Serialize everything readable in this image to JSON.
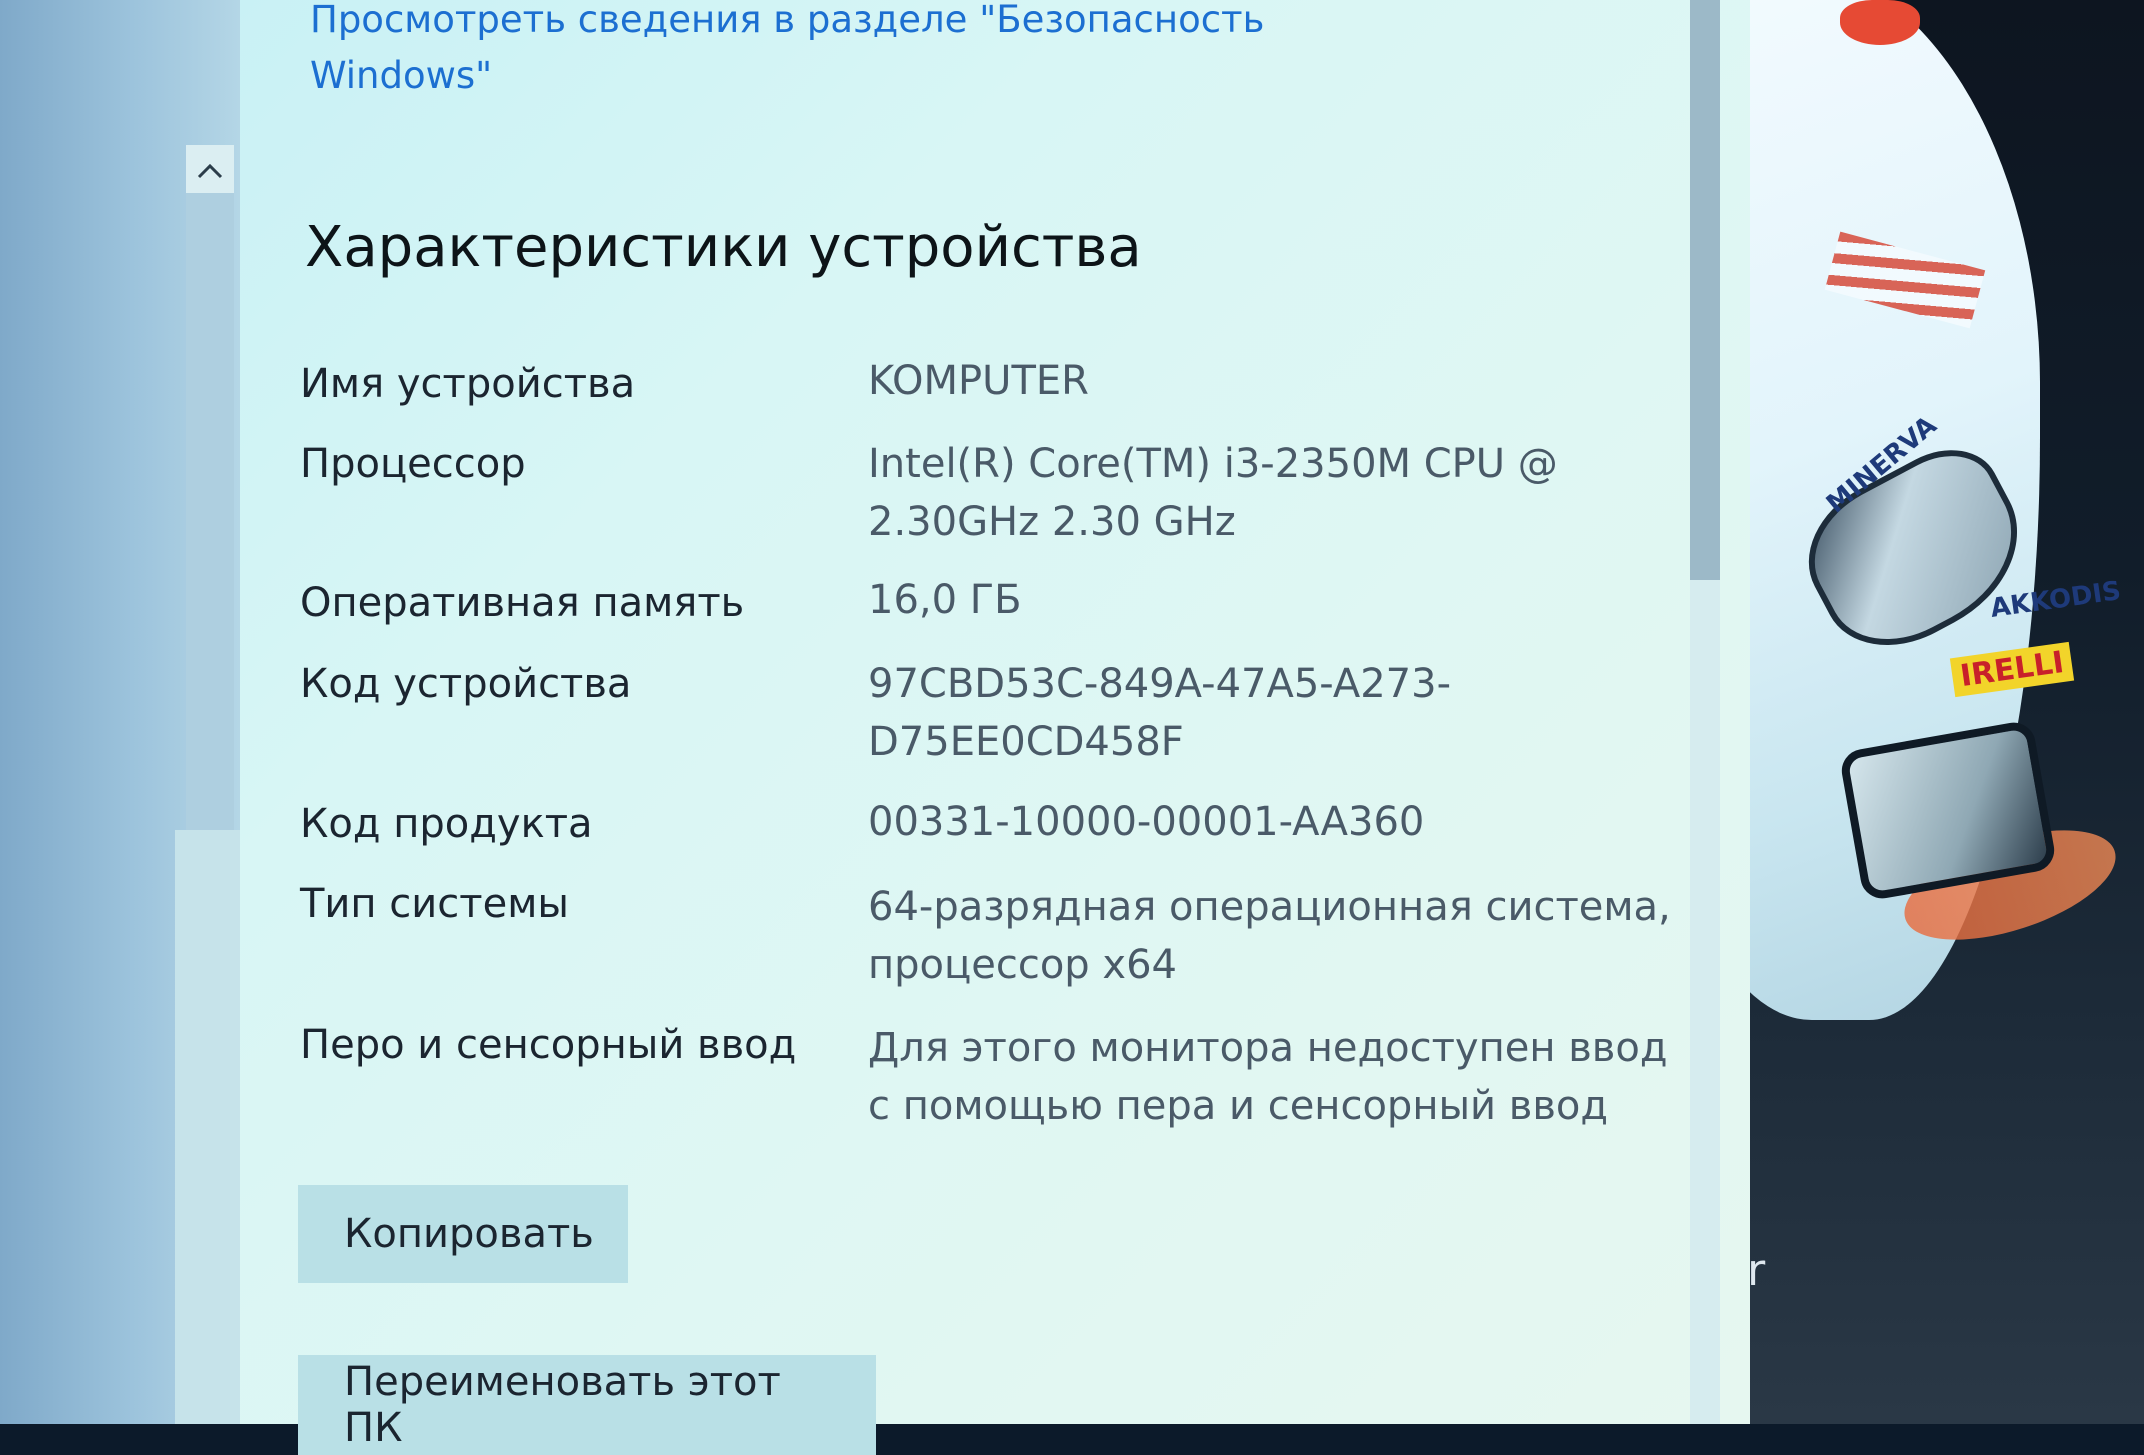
{
  "security_link": {
    "text": "Просмотреть сведения в разделе \"Безопасность Windows\""
  },
  "device_specs": {
    "heading": "Характеристики устройства",
    "rows": [
      {
        "label": "Имя устройства",
        "value": "KOMPUTER"
      },
      {
        "label": "Процессор",
        "value": "Intel(R) Core(TM) i3-2350M CPU @ 2.30GHz   2.30 GHz"
      },
      {
        "label": "Оперативная память",
        "value": "16,0 ГБ"
      },
      {
        "label": "Код устройства",
        "value": "97CBD53C-849A-47A5-A273-D75EE0CD458F"
      },
      {
        "label": "Код продукта",
        "value": "00331-10000-00001-AA360"
      },
      {
        "label": "Тип системы",
        "value": "64-разрядная операционная система, процессор x64"
      },
      {
        "label": "Перо и сенсорный ввод",
        "value": "Для этого монитора недоступен ввод с помощью пера и сенсорный ввод"
      }
    ],
    "copy_button": "Копировать",
    "rename_button": "Переименовать этот ПК"
  },
  "scroll_up_glyph": "^",
  "wallpaper": {
    "sponsor_minerva": "MINERVA",
    "sponsor_akkodis": "AKKODIS",
    "sponsor_pirelli": "IRELLI",
    "partial_text": "er"
  },
  "colors": {
    "link": "#1c6fd1",
    "panel_bg": "#d8f6f5",
    "button_bg": "#b9e0e6"
  }
}
